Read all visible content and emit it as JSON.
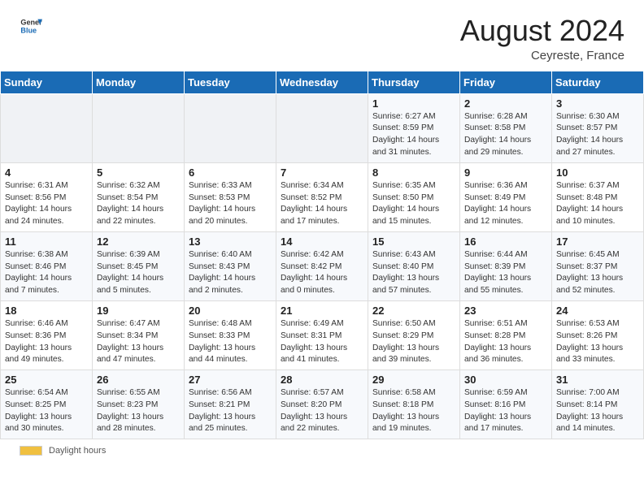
{
  "header": {
    "logo_line1": "General",
    "logo_line2": "Blue",
    "month_year": "August 2024",
    "location": "Ceyreste, France"
  },
  "days_of_week": [
    "Sunday",
    "Monday",
    "Tuesday",
    "Wednesday",
    "Thursday",
    "Friday",
    "Saturday"
  ],
  "weeks": [
    [
      {
        "day": "",
        "info": ""
      },
      {
        "day": "",
        "info": ""
      },
      {
        "day": "",
        "info": ""
      },
      {
        "day": "",
        "info": ""
      },
      {
        "day": "1",
        "info": "Sunrise: 6:27 AM\nSunset: 8:59 PM\nDaylight: 14 hours\nand 31 minutes."
      },
      {
        "day": "2",
        "info": "Sunrise: 6:28 AM\nSunset: 8:58 PM\nDaylight: 14 hours\nand 29 minutes."
      },
      {
        "day": "3",
        "info": "Sunrise: 6:30 AM\nSunset: 8:57 PM\nDaylight: 14 hours\nand 27 minutes."
      }
    ],
    [
      {
        "day": "4",
        "info": "Sunrise: 6:31 AM\nSunset: 8:56 PM\nDaylight: 14 hours\nand 24 minutes."
      },
      {
        "day": "5",
        "info": "Sunrise: 6:32 AM\nSunset: 8:54 PM\nDaylight: 14 hours\nand 22 minutes."
      },
      {
        "day": "6",
        "info": "Sunrise: 6:33 AM\nSunset: 8:53 PM\nDaylight: 14 hours\nand 20 minutes."
      },
      {
        "day": "7",
        "info": "Sunrise: 6:34 AM\nSunset: 8:52 PM\nDaylight: 14 hours\nand 17 minutes."
      },
      {
        "day": "8",
        "info": "Sunrise: 6:35 AM\nSunset: 8:50 PM\nDaylight: 14 hours\nand 15 minutes."
      },
      {
        "day": "9",
        "info": "Sunrise: 6:36 AM\nSunset: 8:49 PM\nDaylight: 14 hours\nand 12 minutes."
      },
      {
        "day": "10",
        "info": "Sunrise: 6:37 AM\nSunset: 8:48 PM\nDaylight: 14 hours\nand 10 minutes."
      }
    ],
    [
      {
        "day": "11",
        "info": "Sunrise: 6:38 AM\nSunset: 8:46 PM\nDaylight: 14 hours\nand 7 minutes."
      },
      {
        "day": "12",
        "info": "Sunrise: 6:39 AM\nSunset: 8:45 PM\nDaylight: 14 hours\nand 5 minutes."
      },
      {
        "day": "13",
        "info": "Sunrise: 6:40 AM\nSunset: 8:43 PM\nDaylight: 14 hours\nand 2 minutes."
      },
      {
        "day": "14",
        "info": "Sunrise: 6:42 AM\nSunset: 8:42 PM\nDaylight: 14 hours\nand 0 minutes."
      },
      {
        "day": "15",
        "info": "Sunrise: 6:43 AM\nSunset: 8:40 PM\nDaylight: 13 hours\nand 57 minutes."
      },
      {
        "day": "16",
        "info": "Sunrise: 6:44 AM\nSunset: 8:39 PM\nDaylight: 13 hours\nand 55 minutes."
      },
      {
        "day": "17",
        "info": "Sunrise: 6:45 AM\nSunset: 8:37 PM\nDaylight: 13 hours\nand 52 minutes."
      }
    ],
    [
      {
        "day": "18",
        "info": "Sunrise: 6:46 AM\nSunset: 8:36 PM\nDaylight: 13 hours\nand 49 minutes."
      },
      {
        "day": "19",
        "info": "Sunrise: 6:47 AM\nSunset: 8:34 PM\nDaylight: 13 hours\nand 47 minutes."
      },
      {
        "day": "20",
        "info": "Sunrise: 6:48 AM\nSunset: 8:33 PM\nDaylight: 13 hours\nand 44 minutes."
      },
      {
        "day": "21",
        "info": "Sunrise: 6:49 AM\nSunset: 8:31 PM\nDaylight: 13 hours\nand 41 minutes."
      },
      {
        "day": "22",
        "info": "Sunrise: 6:50 AM\nSunset: 8:29 PM\nDaylight: 13 hours\nand 39 minutes."
      },
      {
        "day": "23",
        "info": "Sunrise: 6:51 AM\nSunset: 8:28 PM\nDaylight: 13 hours\nand 36 minutes."
      },
      {
        "day": "24",
        "info": "Sunrise: 6:53 AM\nSunset: 8:26 PM\nDaylight: 13 hours\nand 33 minutes."
      }
    ],
    [
      {
        "day": "25",
        "info": "Sunrise: 6:54 AM\nSunset: 8:25 PM\nDaylight: 13 hours\nand 30 minutes."
      },
      {
        "day": "26",
        "info": "Sunrise: 6:55 AM\nSunset: 8:23 PM\nDaylight: 13 hours\nand 28 minutes."
      },
      {
        "day": "27",
        "info": "Sunrise: 6:56 AM\nSunset: 8:21 PM\nDaylight: 13 hours\nand 25 minutes."
      },
      {
        "day": "28",
        "info": "Sunrise: 6:57 AM\nSunset: 8:20 PM\nDaylight: 13 hours\nand 22 minutes."
      },
      {
        "day": "29",
        "info": "Sunrise: 6:58 AM\nSunset: 8:18 PM\nDaylight: 13 hours\nand 19 minutes."
      },
      {
        "day": "30",
        "info": "Sunrise: 6:59 AM\nSunset: 8:16 PM\nDaylight: 13 hours\nand 17 minutes."
      },
      {
        "day": "31",
        "info": "Sunrise: 7:00 AM\nSunset: 8:14 PM\nDaylight: 13 hours\nand 14 minutes."
      }
    ]
  ],
  "footer": {
    "daylight_label": "Daylight hours"
  }
}
